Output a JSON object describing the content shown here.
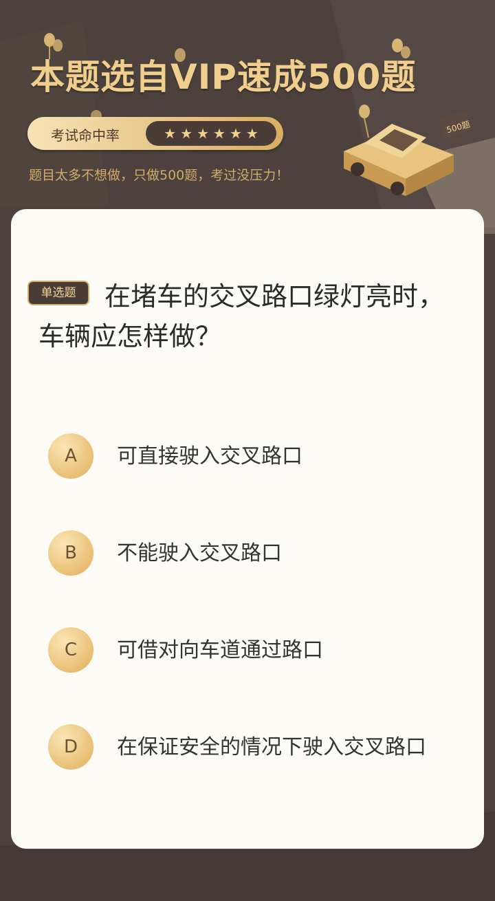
{
  "header": {
    "title": "本题选自VIP速成500题",
    "hit_rate_label": "考试命中率",
    "stars": 6,
    "subtitle": "题目太多不想做，只做500题，考过没压力！",
    "car_sign": "500题"
  },
  "question": {
    "type_tag": "单选题",
    "text": "在堵车的交叉路口绿灯亮时，车辆应怎样做？"
  },
  "options": [
    {
      "letter": "A",
      "text": "可直接驶入交叉路口"
    },
    {
      "letter": "B",
      "text": "不能驶入交叉路口"
    },
    {
      "letter": "C",
      "text": "可借对向车道通过路口"
    },
    {
      "letter": "D",
      "text": "在保证安全的情况下驶入交叉路口"
    }
  ],
  "colors": {
    "background": "#4c413d",
    "gold": "#f0cf8e",
    "card": "#fdfbf5",
    "dark_tag": "#4a3d37"
  }
}
